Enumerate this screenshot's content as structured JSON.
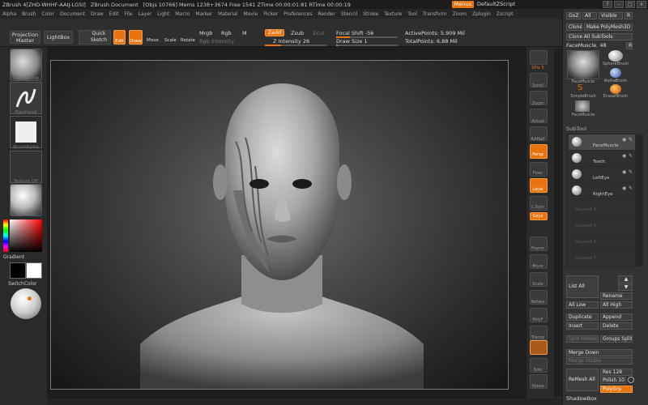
{
  "titlebar": {
    "app": "ZBrush 4[ZHD-WHHF-AAIJ-LGSI]",
    "doc": "ZBrush Document",
    "stats": "[Objs 10766]  Mems 1238+3674  Free 1541  ZTime 00:00:01:81  RTime 00:00:19",
    "menus_btn": "Menus",
    "script": "DefaultZScript"
  },
  "menubar": [
    "Alpha",
    "Brush",
    "Color",
    "Document",
    "Draw",
    "Edit",
    "File",
    "Layer",
    "Light",
    "Macro",
    "Marker",
    "Material",
    "Movie",
    "Picker",
    "Preferences",
    "Render",
    "Stencil",
    "Stroke",
    "Texture",
    "Tool",
    "Transform",
    "Zoom",
    "Zplugin",
    "Zscript"
  ],
  "shelf": {
    "projection_master": "Projection Master",
    "lightbox": "LightBox",
    "quick_sketch": "Quick Sketch",
    "edit": "Edit",
    "draw": "Draw",
    "move": "Move",
    "scale": "Scale",
    "rotate": "Rotate",
    "mrgb": "Mrgb",
    "rgb": "Rgb",
    "m": "M",
    "rgb_intensity": "Rgb Intensity",
    "zadd": "Zadd",
    "zsub": "Zsub",
    "zcut": "Zcut",
    "z_intensity": "Z Intensity 26",
    "focal_shift": "Focal Shift -56",
    "draw_size": "Draw Size 1",
    "active_points": "ActivePoints: 5.909 Mil",
    "total_points": "TotalPoints: 6.88 Mil",
    "z_intensity_level": 0.26,
    "focal_shift_level": 0.22,
    "draw_size_level": 0.02
  },
  "left": {
    "brush": "ClayBuildup",
    "stroke": "FreeHand",
    "alpha": "BrushAlpha",
    "texture": "Texture Off",
    "material": "ToyPlastic",
    "gradient": "Gradient",
    "switchcolor": "SwitchColor"
  },
  "rstrip": [
    "BPR",
    "SPix 3",
    "Scroll",
    "Zoom",
    "Actual",
    "AAHalf",
    "Persp",
    "Floor",
    "Local",
    "L.Sym",
    "Gxyz",
    "Frame",
    "Move",
    "Scale",
    "Rotate",
    "PolyF",
    "Transp",
    "Solo",
    "Xpose"
  ],
  "rpanel": {
    "goz": "GoZ",
    "all": "All",
    "visible": "Visible",
    "r": "R",
    "clone": "Clone",
    "make_polymesh": "Make PolyMesh3D",
    "clone_all": "Clone All SubTools",
    "tool_name": "FaceMuscle. 48",
    "tools": [
      "FaceMuscle",
      "SphereBrush",
      "AlphaBrush",
      "SimpleBrush",
      "EraserBrush",
      "FaceMuscle"
    ],
    "subtool_header": "SubTool",
    "subtools": [
      "FaceMuscle",
      "Teeth",
      "LeftEye",
      "RightEye",
      "Unused 4",
      "Unused 5",
      "Unused 6",
      "Unused 7"
    ],
    "list_all": "List All",
    "rename": "Rename",
    "all_low": "All Low",
    "all_high": "All High",
    "duplicate": "Duplicate",
    "append": "Append",
    "insert": "Insert",
    "delete": "Delete",
    "split_hidden": "Split Hidden",
    "groups_split": "Groups Split",
    "merge_down": "Merge Down",
    "merge_visible": "Merge Visible",
    "remesh_all": "ReMesh All",
    "res": "Res 128",
    "polish": "Polish 10",
    "polygrp": "PolyGrp",
    "shadowbox": "ShadowBox"
  },
  "colors": {
    "accent": "#e8730f"
  }
}
